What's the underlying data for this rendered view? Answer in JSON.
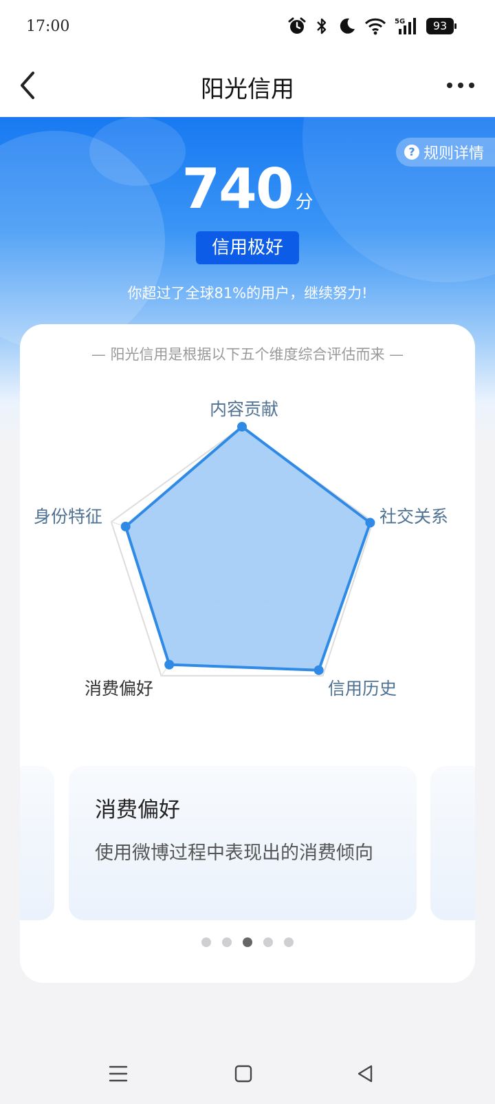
{
  "status_bar": {
    "time": "17:00",
    "battery": "93",
    "icons": [
      "alarm-icon",
      "bluetooth-icon",
      "moon-icon",
      "wifi-icon",
      "5g-signal-icon"
    ]
  },
  "header": {
    "title": "阳光信用",
    "back_icon": "chevron-left-icon",
    "more_icon": "more-dots-icon"
  },
  "hero": {
    "rules_label": "规则详情",
    "score": "740",
    "score_unit": "分",
    "level": "信用极好",
    "beat_text": "你超过了全球81%的用户，继续努力!"
  },
  "card": {
    "intro": "— 阳光信用是根据以下五个维度综合评估而来 —",
    "dimensions": [
      {
        "label": "内容贡献",
        "value": 1.0
      },
      {
        "label": "社交关系",
        "value": 0.98
      },
      {
        "label": "信用历史",
        "value": 0.95
      },
      {
        "label": "消费偏好",
        "value": 0.9
      },
      {
        "label": "身份特征",
        "value": 0.89
      }
    ],
    "slides": [
      {
        "title": "消费偏好",
        "desc": "使用微博过程中表现出的消费倾向"
      }
    ],
    "pagination": {
      "count": 5,
      "active": 3
    }
  },
  "colors": {
    "primary": "#1879f2",
    "badge": "#0d5ce8",
    "radar_stroke": "#2f8ae5",
    "radar_fill": "#a6cdf8",
    "dim_label": "#4f7192"
  },
  "nav_bar": {
    "icons": [
      "menu-icon",
      "home-square-icon",
      "back-triangle-icon"
    ]
  }
}
